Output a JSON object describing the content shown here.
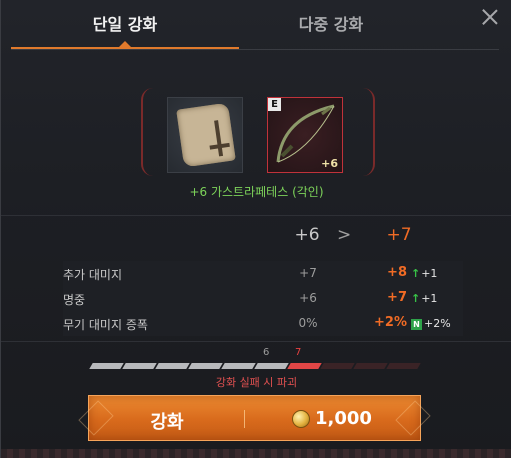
{
  "tabs": {
    "single": "단일 강화",
    "multi": "다중 강화"
  },
  "item": {
    "name": "+6 가스트라페테스 (각인)",
    "grade": "E",
    "level_badge": "+6"
  },
  "levels": {
    "current": "+6",
    "arrow": ">",
    "next": "+7"
  },
  "stats": [
    {
      "name": "추가 대미지",
      "current": "+7",
      "next": "+8",
      "diff": "+1",
      "diff_icon": "up-arrow"
    },
    {
      "name": "명중",
      "current": "+6",
      "next": "+7",
      "diff": "+1",
      "diff_icon": "up-arrow"
    },
    {
      "name": "무기 대미지 증폭",
      "current": "0%",
      "next": "+2%",
      "diff": "+2%",
      "diff_icon": "new-badge",
      "badge_text": "N"
    }
  ],
  "progress": {
    "label_current": "6",
    "label_next": "7",
    "total_segments": 10,
    "filled_segments": 6,
    "current_segment": 7,
    "fail_text": "강화 실패 시 파괴"
  },
  "enhance_button": {
    "label": "강화",
    "cost": "1,000",
    "currency_icon": "gold-coin-icon"
  },
  "colors": {
    "accent": "#e07a2c",
    "highlight": "#f06b25",
    "item_name": "#7dd35a",
    "danger": "#e05050"
  }
}
